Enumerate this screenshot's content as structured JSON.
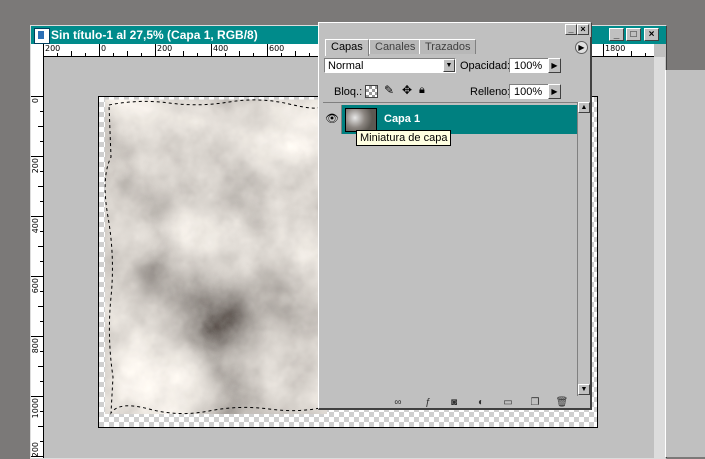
{
  "document": {
    "title": "Sin título-1 al 27,5% (Capa 1, RGB/8)",
    "ruler_top": [
      "200",
      "0",
      "200",
      "400",
      "600",
      "1800"
    ],
    "ruler_left": [
      "0",
      "200",
      "400",
      "600",
      "800",
      "1000",
      "1200"
    ]
  },
  "window_buttons": {
    "minimize": "_",
    "maximize": "□",
    "close": "×"
  },
  "layers_panel": {
    "tabs": [
      "Capas",
      "Canales",
      "Trazados"
    ],
    "blend_mode": "Normal",
    "opacity_label": "Opacidad:",
    "opacity_value": "100%",
    "lock_label": "Bloq.:",
    "fill_label": "Relleno:",
    "fill_value": "100%",
    "layers": [
      {
        "name": "Capa 1",
        "visible": true,
        "selected": true
      }
    ],
    "tooltip": "Miniatura de capa",
    "icons": [
      "link-icon",
      "layer-style-icon",
      "mask-icon",
      "adjustment-layer-icon",
      "layer-set-icon",
      "new-layer-icon",
      "trash-icon"
    ]
  },
  "colors": {
    "titlebar": "#008b8b",
    "selected_layer": "#008080",
    "tooltip_bg": "#ffffe1"
  }
}
